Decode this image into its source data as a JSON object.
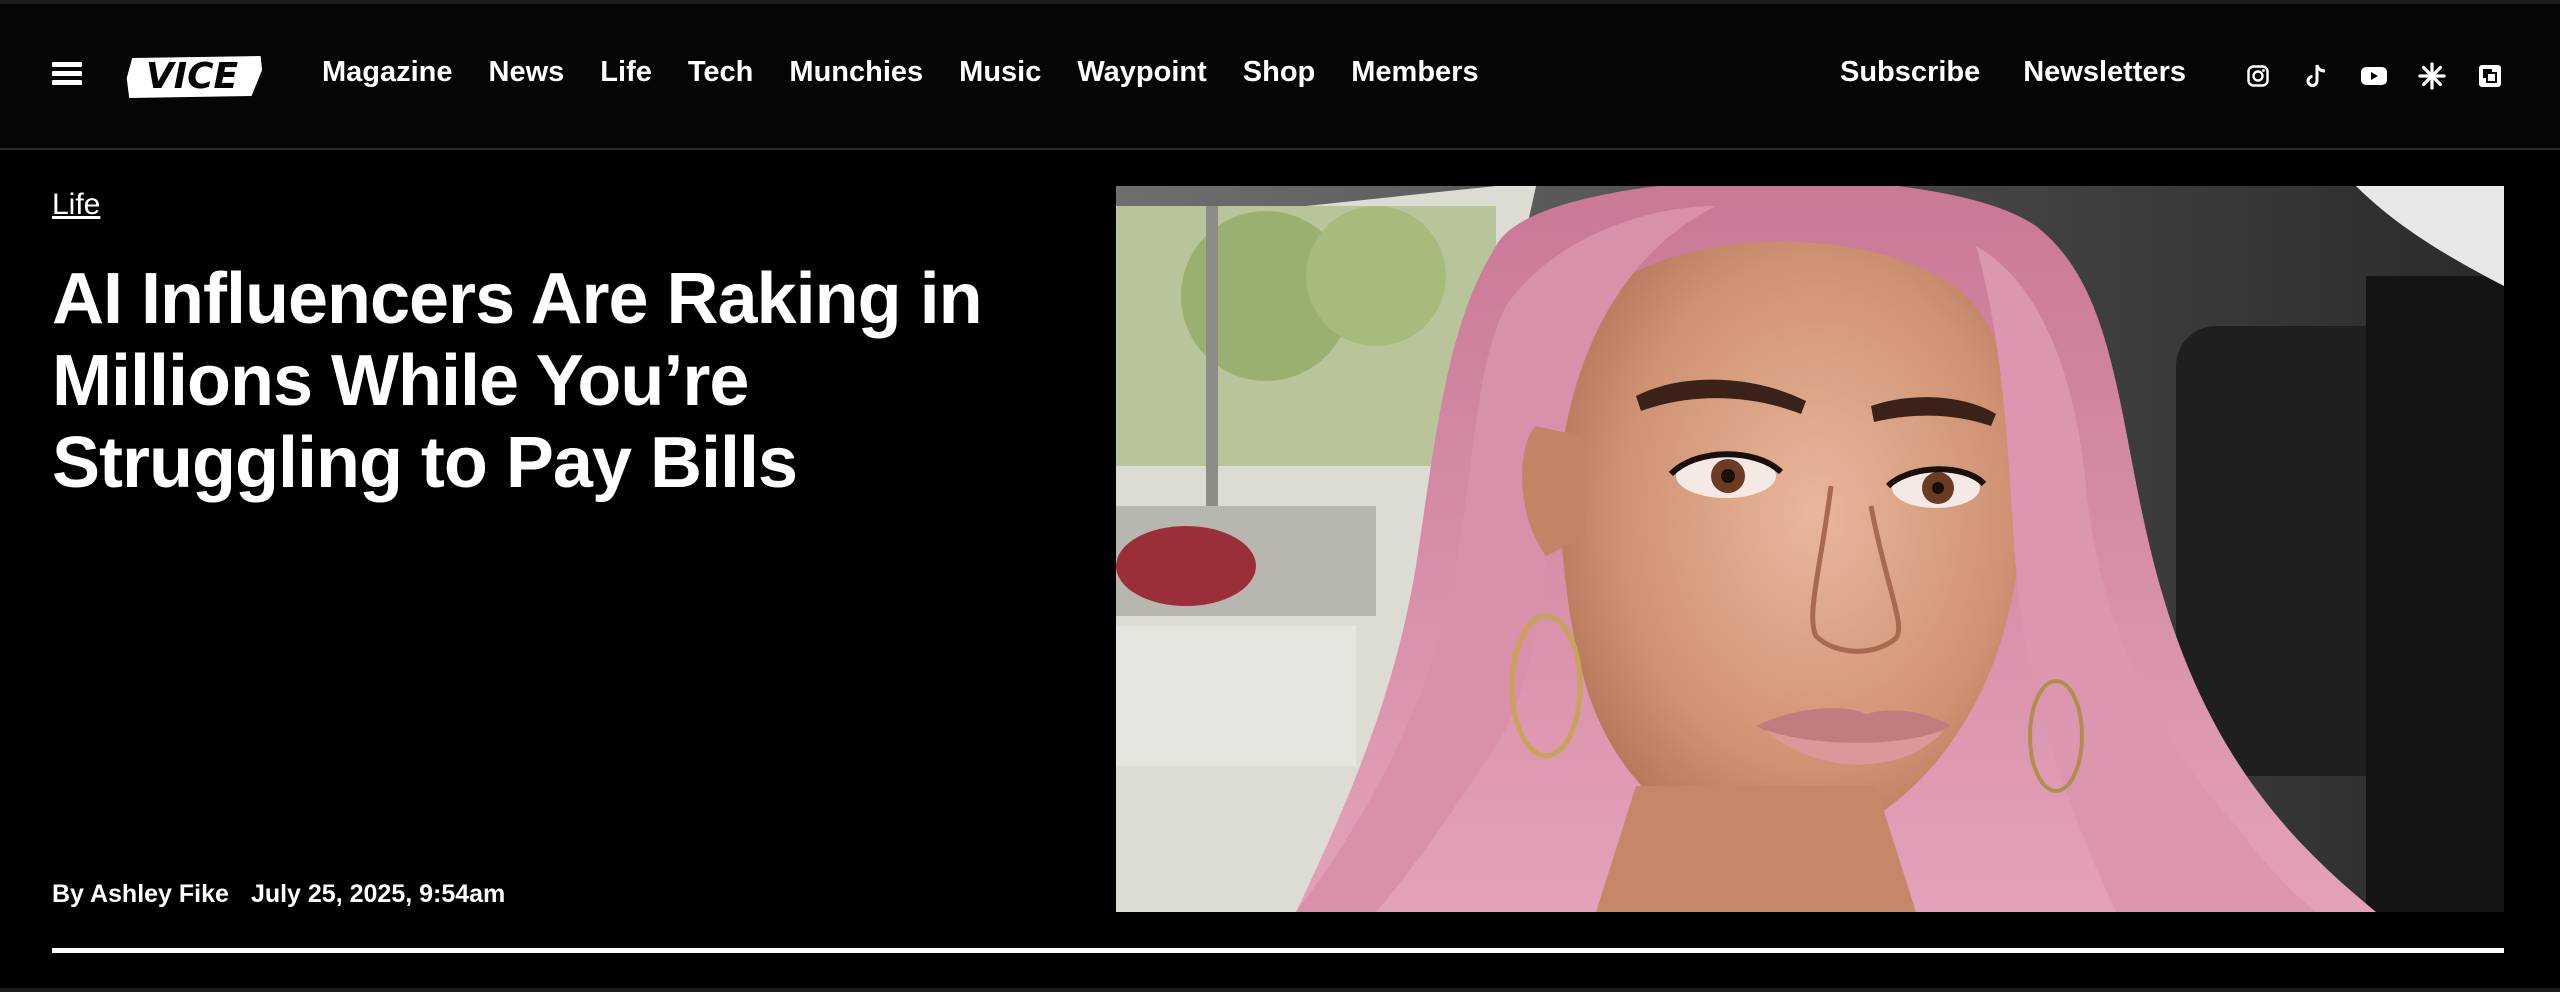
{
  "header": {
    "logo_text": "VICE",
    "nav_primary": [
      "Magazine",
      "News",
      "Life",
      "Tech",
      "Munchies",
      "Music",
      "Waypoint",
      "Shop",
      "Members"
    ],
    "nav_secondary": [
      "Subscribe",
      "Newsletters"
    ],
    "social_icons": [
      "instagram-icon",
      "tiktok-icon",
      "youtube-icon",
      "asterisk-icon",
      "flipboard-icon"
    ]
  },
  "article": {
    "category": "Life",
    "headline_lines": [
      "AI Influencers Are Raking in",
      "Millions While You’re",
      "Struggling to Pay Bills"
    ],
    "byline": "By Ashley Fike",
    "date": "July 25, 2025, 9:54am"
  },
  "colors": {
    "background": "#000000",
    "text": "#ffffff",
    "hair": "#d98aa8"
  }
}
